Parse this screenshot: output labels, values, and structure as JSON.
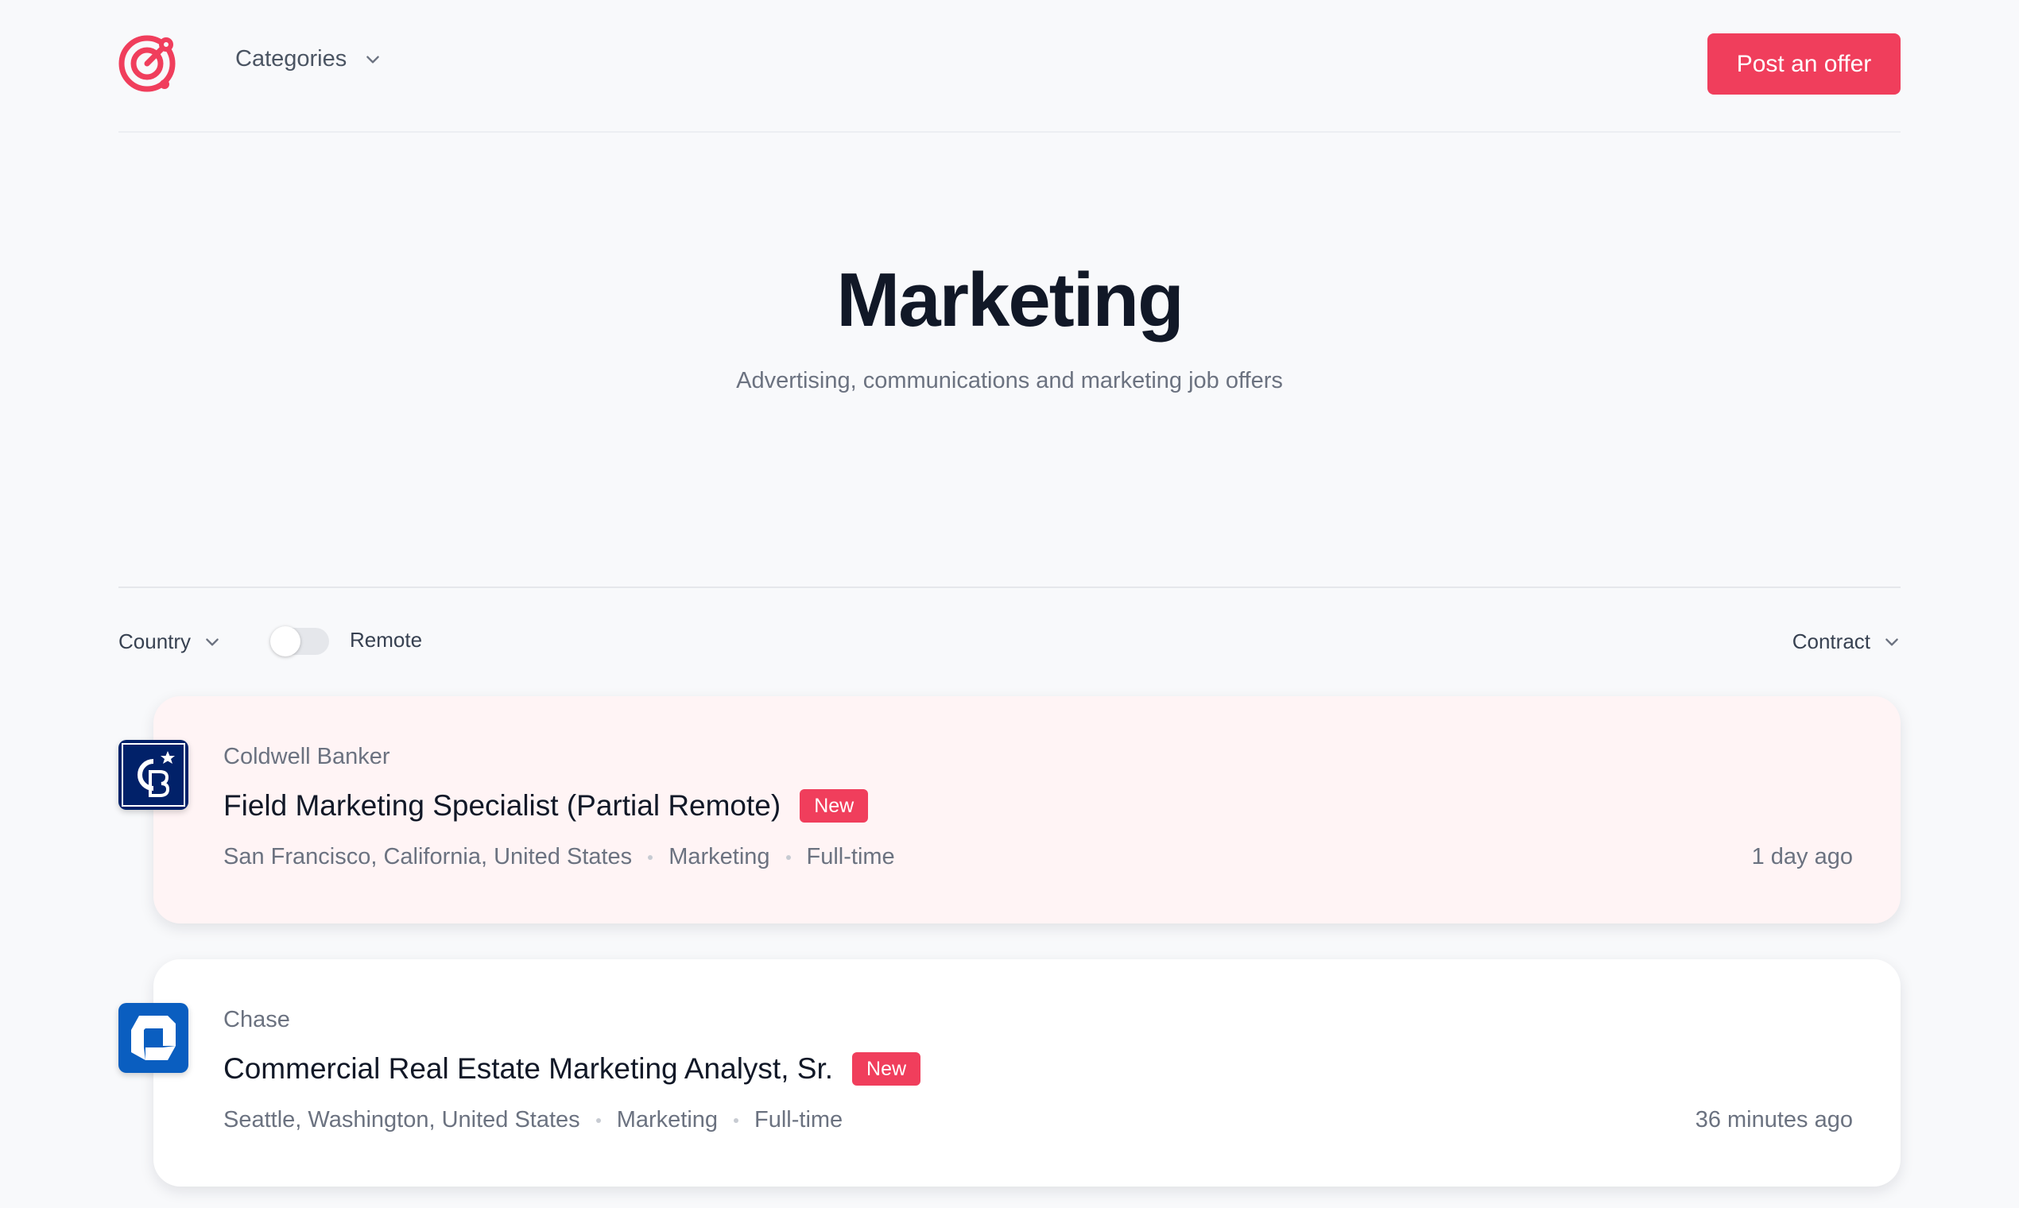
{
  "header": {
    "categories_label": "Categories",
    "post_offer_label": "Post an offer",
    "brand_color": "#f03e5c"
  },
  "hero": {
    "title": "Marketing",
    "subtitle": "Advertising, communications and marketing job offers"
  },
  "filters": {
    "country_label": "Country",
    "remote_label": "Remote",
    "remote_enabled": false,
    "contract_label": "Contract"
  },
  "jobs": [
    {
      "company": "Coldwell Banker",
      "logo_icon": "coldwell-banker-logo-icon",
      "logo_color": "#012169",
      "title": "Field Marketing Specialist (Partial Remote)",
      "badge": "New",
      "location": "San Francisco, California, United States",
      "category": "Marketing",
      "contract": "Full-time",
      "posted": "1 day ago",
      "highlighted": true
    },
    {
      "company": "Chase",
      "logo_icon": "chase-logo-icon",
      "logo_color": "#0a5ec0",
      "title": "Commercial Real Estate Marketing Analyst, Sr.",
      "badge": "New",
      "location": "Seattle, Washington, United States",
      "category": "Marketing",
      "contract": "Full-time",
      "posted": "36 minutes ago",
      "highlighted": false
    }
  ]
}
